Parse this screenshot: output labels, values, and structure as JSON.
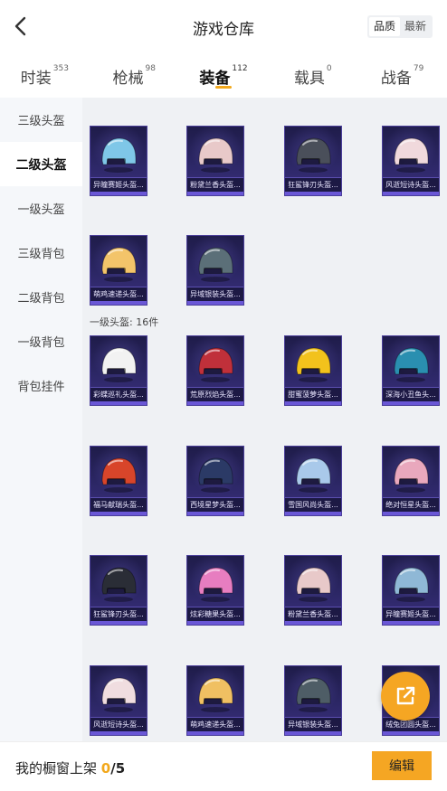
{
  "header": {
    "title": "游戏仓库",
    "sort_quality": "品质",
    "sort_newest": "最新"
  },
  "tabs": [
    {
      "label": "时装",
      "count": "353"
    },
    {
      "label": "枪械",
      "count": "98"
    },
    {
      "label": "装备",
      "count": "112"
    },
    {
      "label": "载具",
      "count": "0"
    },
    {
      "label": "战备",
      "count": "79"
    }
  ],
  "sidebar": [
    {
      "label": "三级头盔"
    },
    {
      "label": "二级头盔"
    },
    {
      "label": "一级头盔"
    },
    {
      "label": "三级背包"
    },
    {
      "label": "二级背包"
    },
    {
      "label": "一级背包"
    },
    {
      "label": "背包挂件"
    }
  ],
  "level2_helmets": [
    {
      "name": "异瞳赛姬头盔...",
      "color": "#7fc7e8"
    },
    {
      "name": "粉黛兰香头盔...",
      "color": "#e8c9c9"
    },
    {
      "name": "狂鲨锋刃头盔...",
      "color": "#4a4f5a"
    },
    {
      "name": "风逝短诗头盔...",
      "color": "#f0d9dc"
    },
    {
      "name": "萌鸡速递头盔...",
      "color": "#f3c46a"
    },
    {
      "name": "异域银装头盔...",
      "color": "#5b6f78"
    }
  ],
  "level1_group_title": "一级头盔: 16件",
  "level1_helmets": [
    {
      "name": "彩蝶巡礼头盔...",
      "color": "#f2f2f2"
    },
    {
      "name": "荒原烈焰头盔...",
      "color": "#c0303a"
    },
    {
      "name": "甜蜜菠萝头盔...",
      "color": "#f2c21c"
    },
    {
      "name": "深海小丑鱼头...",
      "color": "#2a8fb0"
    },
    {
      "name": "福马献瑞头盔...",
      "color": "#d8452a"
    },
    {
      "name": "西境星梦头盔...",
      "color": "#2b3a66"
    },
    {
      "name": "雪国风尚头盔...",
      "color": "#a9c9ea"
    },
    {
      "name": "绝对恒星头盔...",
      "color": "#e9a8bd"
    },
    {
      "name": "狂鲨锋刃头盔...",
      "color": "#2a2d36"
    },
    {
      "name": "炫彩糖果头盔...",
      "color": "#e77dc0"
    },
    {
      "name": "粉黛兰香头盔...",
      "color": "#e8c9c9"
    },
    {
      "name": "异瞳赛姬头盔...",
      "color": "#8fb8d6"
    },
    {
      "name": "风逝短诗头盔...",
      "color": "#f0dde0"
    },
    {
      "name": "萌鸡速递头盔...",
      "color": "#f0c062"
    },
    {
      "name": "异域银装头盔...",
      "color": "#4e5d66"
    },
    {
      "name": "绒兔团圆头盔...",
      "color": "#3d4f7a"
    }
  ],
  "footer": {
    "text": "我的橱窗上架 ",
    "current": "0",
    "total": "/5",
    "edit_label": "编辑"
  },
  "colors": {
    "accent": "#f5a623",
    "card_bg": "#2c2766"
  }
}
